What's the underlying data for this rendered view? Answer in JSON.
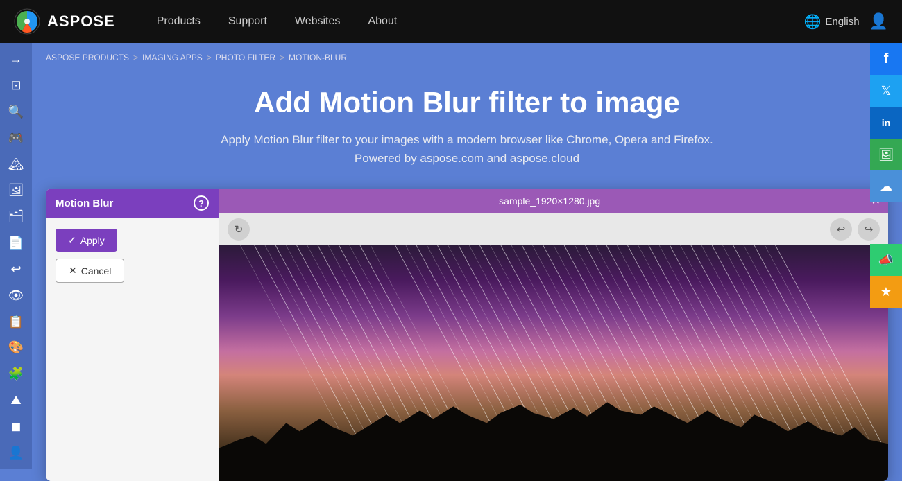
{
  "nav": {
    "logo_text": "ASPOSE",
    "links": [
      {
        "label": "Products",
        "id": "products"
      },
      {
        "label": "Support",
        "id": "support"
      },
      {
        "label": "Websites",
        "id": "websites"
      },
      {
        "label": "About",
        "id": "about"
      }
    ],
    "language": "English"
  },
  "breadcrumb": {
    "items": [
      {
        "label": "ASPOSE PRODUCTS",
        "href": "#"
      },
      {
        "label": "IMAGING APPS",
        "href": "#"
      },
      {
        "label": "PHOTO FILTER",
        "href": "#"
      },
      {
        "label": "MOTION-BLUR",
        "href": "#"
      }
    ]
  },
  "hero": {
    "title": "Add Motion Blur filter to image",
    "description": "Apply Motion Blur filter to your images with a modern browser like Chrome, Opera and Firefox.",
    "powered_by": "Powered by aspose.com and aspose.cloud"
  },
  "filter_panel": {
    "filter_name": "Motion Blur",
    "help_label": "?",
    "apply_label": "Apply",
    "cancel_label": "Cancel"
  },
  "image_viewer": {
    "filename": "sample_1920×1280.jpg",
    "close_label": "×"
  },
  "sidebar": {
    "icons": [
      {
        "name": "arrow-right-icon",
        "symbol": "→"
      },
      {
        "name": "frame-icon",
        "symbol": "⊞"
      },
      {
        "name": "search-icon",
        "symbol": "🔍"
      },
      {
        "name": "game-icon",
        "symbol": "🎮"
      },
      {
        "name": "landscape-icon",
        "symbol": "🏔"
      },
      {
        "name": "image-icon",
        "symbol": "🖼"
      },
      {
        "name": "portrait-icon",
        "symbol": "👤"
      },
      {
        "name": "document-icon",
        "symbol": "📄"
      },
      {
        "name": "undo-icon",
        "symbol": "↩"
      },
      {
        "name": "eye-icon",
        "symbol": "👁"
      },
      {
        "name": "list-icon",
        "symbol": "📋"
      },
      {
        "name": "gallery-icon",
        "symbol": "🎨"
      },
      {
        "name": "puzzle-icon",
        "symbol": "🧩"
      },
      {
        "name": "mountain-icon",
        "symbol": "⛰"
      },
      {
        "name": "filter-icon",
        "symbol": "🔲"
      },
      {
        "name": "person-icon",
        "symbol": "👤"
      }
    ]
  },
  "social": [
    {
      "name": "facebook-icon",
      "symbol": "f",
      "class": "fb"
    },
    {
      "name": "twitter-icon",
      "symbol": "🐦",
      "class": "tw"
    },
    {
      "name": "linkedin-icon",
      "symbol": "in",
      "class": "li"
    },
    {
      "name": "image-share-icon",
      "symbol": "🖼",
      "class": "img-share"
    },
    {
      "name": "cloud-icon",
      "symbol": "☁",
      "class": "cloud"
    },
    {
      "name": "announce-icon",
      "symbol": "📣",
      "class": "announce"
    },
    {
      "name": "star-icon",
      "symbol": "★",
      "class": "star"
    }
  ]
}
